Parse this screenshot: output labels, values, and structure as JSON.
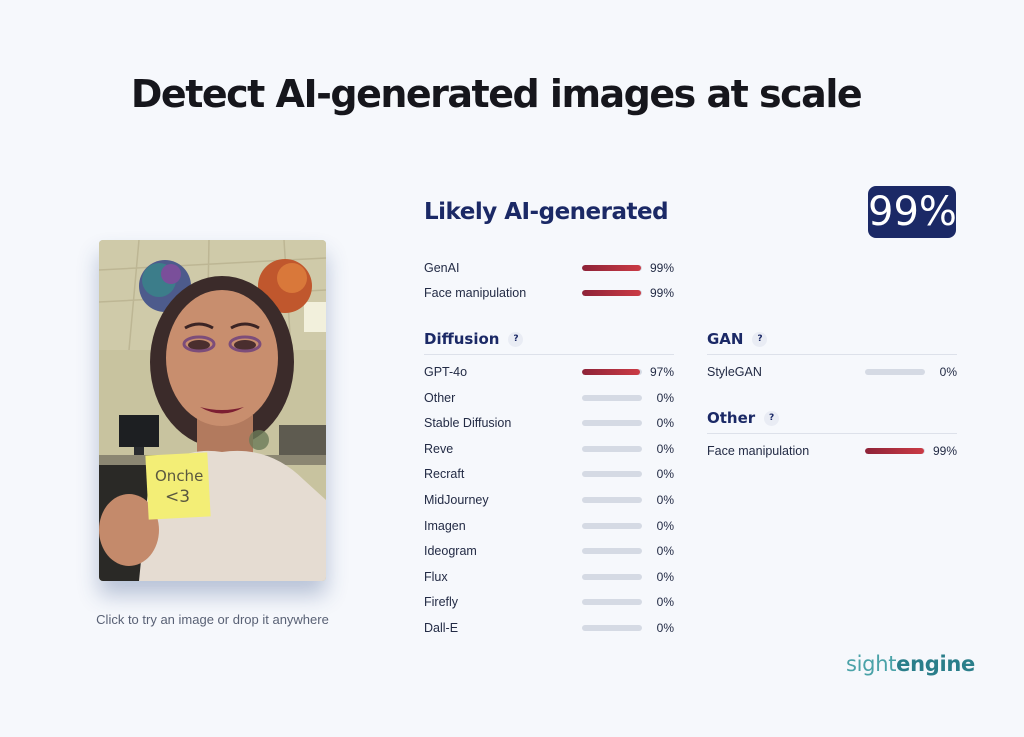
{
  "headline": "Detect AI-generated images at scale",
  "upload": {
    "hint": "Click to try an image or drop it anywhere",
    "note_text_line1": "Onche",
    "note_text_line2": "<3"
  },
  "result": {
    "verdict": "Likely AI-generated",
    "score": "99%",
    "summary": [
      {
        "label": "GenAI",
        "value": 0.99,
        "pct": "99%"
      },
      {
        "label": "Face manipulation",
        "value": 0.99,
        "pct": "99%"
      }
    ]
  },
  "sections": {
    "diffusion": {
      "title": "Diffusion",
      "help": "?",
      "rows": [
        {
          "label": "GPT-4o",
          "value": 0.97,
          "pct": "97%"
        },
        {
          "label": "Other",
          "value": 0,
          "pct": "0%"
        },
        {
          "label": "Stable Diffusion",
          "value": 0,
          "pct": "0%"
        },
        {
          "label": "Reve",
          "value": 0,
          "pct": "0%"
        },
        {
          "label": "Recraft",
          "value": 0,
          "pct": "0%"
        },
        {
          "label": "MidJourney",
          "value": 0,
          "pct": "0%"
        },
        {
          "label": "Imagen",
          "value": 0,
          "pct": "0%"
        },
        {
          "label": "Ideogram",
          "value": 0,
          "pct": "0%"
        },
        {
          "label": "Flux",
          "value": 0,
          "pct": "0%"
        },
        {
          "label": "Firefly",
          "value": 0,
          "pct": "0%"
        },
        {
          "label": "Dall-E",
          "value": 0,
          "pct": "0%"
        }
      ]
    },
    "gan": {
      "title": "GAN",
      "help": "?",
      "rows": [
        {
          "label": "StyleGAN",
          "value": 0,
          "pct": "0%"
        }
      ]
    },
    "other": {
      "title": "Other",
      "help": "?",
      "rows": [
        {
          "label": "Face manipulation",
          "value": 0.99,
          "pct": "99%"
        }
      ]
    }
  },
  "brand": {
    "part1": "sight",
    "part2": "engine"
  },
  "colors": {
    "accent_navy": "#1b2966",
    "bar_fill_dark": "#8e2338",
    "bar_fill_light": "#cb3b45",
    "bar_track": "#d5dae4",
    "brand_teal": "#2a7e8a"
  }
}
